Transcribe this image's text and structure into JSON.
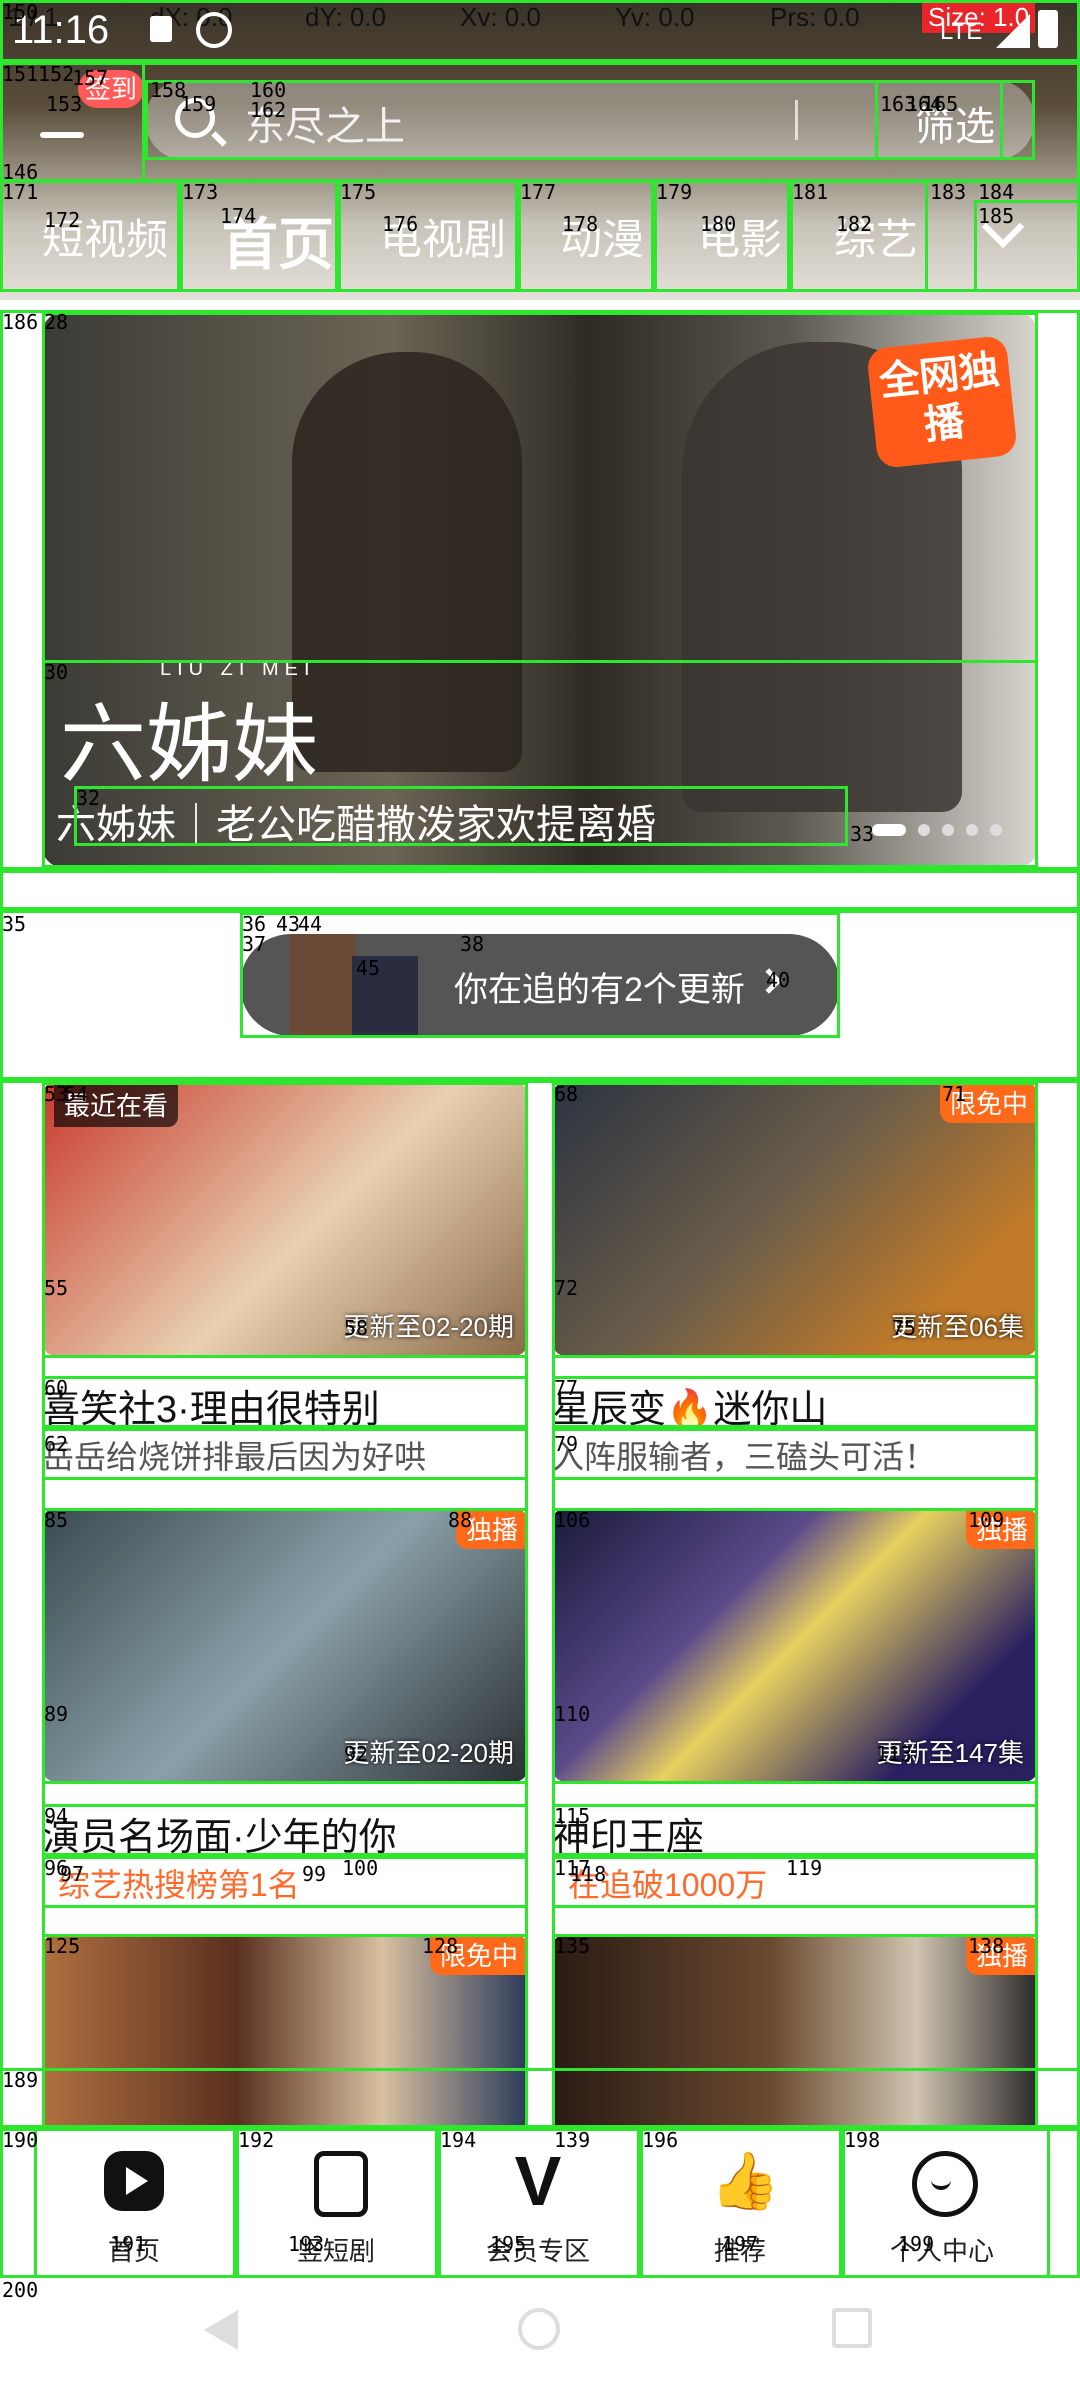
{
  "status": {
    "time": "11:16",
    "pointer": "1 / 1",
    "dx": "dX: 0.0",
    "dy": "dY: 0.0",
    "xv": "Xv: 0.0",
    "yv": "Yv: 0.0",
    "prs": "Prs: 0.0",
    "size": "Size: 1.0",
    "net": "LTE"
  },
  "header": {
    "checkin": "签到",
    "search_placeholder": "东尽之上",
    "filter": "筛选"
  },
  "tabs": [
    {
      "label": "短视频"
    },
    {
      "label": "首页"
    },
    {
      "label": "电视剧"
    },
    {
      "label": "动漫"
    },
    {
      "label": "电影"
    },
    {
      "label": "综艺"
    }
  ],
  "banner": {
    "title_art": "六姊妹",
    "pinyin": "LIU ZI MEI",
    "caption": "六姊妹｜老公吃醋撒泼家欢提离婚",
    "corner_badge": "全网独播"
  },
  "following": {
    "text": "你在追的有2个更新"
  },
  "recent_label": "最近在看",
  "cards": [
    {
      "title": "喜笑社3·理由很特别",
      "sub": "岳岳给烧饼排最后因为好哄",
      "ep": "更新至02-20期",
      "badge": "",
      "sub_hot": false
    },
    {
      "title": "星辰变🔥迷你山",
      "sub": "入阵服输者，三磕头可活！",
      "ep": "更新至06集",
      "badge": "限免中",
      "sub_hot": false
    },
    {
      "title": "演员名场面·少年的你",
      "sub": "综艺热搜榜第1名",
      "ep": "更新至02-20期",
      "badge": "独播",
      "sub_hot": true
    },
    {
      "title": "神印王座",
      "sub": "在追破1000万",
      "ep": "更新至147集",
      "badge": "独播",
      "sub_hot": true
    },
    {
      "title": "",
      "sub": "",
      "ep": "",
      "badge": "限免中",
      "sub_hot": false
    },
    {
      "title": "",
      "sub": "",
      "ep": "",
      "badge": "独播",
      "sub_hot": false
    }
  ],
  "bottom_nav": [
    {
      "label": "首页",
      "icon": "play-logo-icon"
    },
    {
      "label": "竖短剧",
      "icon": "vertical-drama-icon"
    },
    {
      "label": "会员专区",
      "icon": "vip-icon"
    },
    {
      "label": "推荐",
      "icon": "thumbs-up-icon"
    },
    {
      "label": "个人中心",
      "icon": "smile-icon"
    }
  ],
  "debug_tags": [
    "150",
    "151",
    "152",
    "153",
    "157",
    "158",
    "159",
    "160",
    "162",
    "163",
    "164",
    "165",
    "146",
    "171",
    "172",
    "173",
    "174",
    "175",
    "176",
    "177",
    "178",
    "179",
    "180",
    "181",
    "182",
    "183",
    "184",
    "185",
    "186",
    "28",
    "30",
    "32",
    "33",
    "35",
    "36",
    "37",
    "38",
    "40",
    "43",
    "44",
    "45",
    "53",
    "54",
    "55",
    "58",
    "60",
    "62",
    "68",
    "71",
    "72",
    "75",
    "77",
    "79",
    "85",
    "88",
    "89",
    "92",
    "94",
    "96",
    "97",
    "99",
    "100",
    "106",
    "109",
    "110",
    "113",
    "115",
    "117",
    "118",
    "119",
    "125",
    "128",
    "135",
    "138",
    "139",
    "189",
    "190",
    "191",
    "192",
    "193",
    "194",
    "195",
    "196",
    "197",
    "198",
    "199",
    "200"
  ],
  "colors": {
    "accent": "#ff6a1a",
    "debug_box": "#2ee62e",
    "size_bg": "#e8252b"
  }
}
